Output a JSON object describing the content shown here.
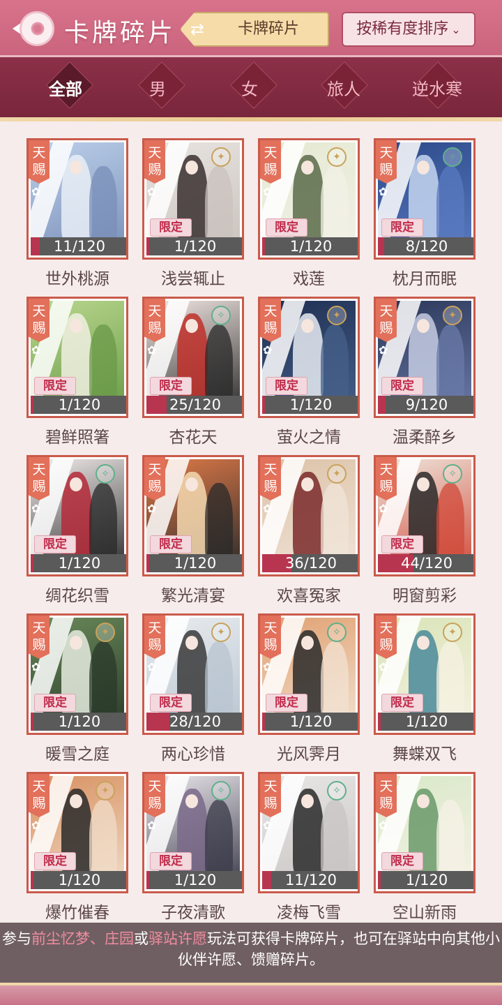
{
  "header": {
    "title": "卡牌碎片",
    "switch_label": "卡牌碎片",
    "sort_label": "按稀有度排序"
  },
  "filters": [
    "全部",
    "男",
    "女",
    "旅人",
    "逆水寒"
  ],
  "active_filter": "全部",
  "colors": {
    "header": "#d9738c",
    "filter_bar": "#8b3048",
    "card_border": "#c95a4a",
    "tianci_tag": "#e2705a",
    "progress_fill": "#b8354f",
    "limited_text": "#c02a4a",
    "highlight": "#f08ca0"
  },
  "cards": [
    {
      "name": "世外桃源",
      "count": "11/120",
      "fraction": 0.092,
      "tag": "天赐",
      "limited": false,
      "badge": "none",
      "palette": [
        "#bcd0ea",
        "#e9eef7",
        "#7a8fb8"
      ]
    },
    {
      "name": "浅尝辄止",
      "count": "1/120",
      "fraction": 0.008,
      "tag": "天赐",
      "limited": true,
      "badge": "gold",
      "palette": [
        "#e8e4e0",
        "#3a3030",
        "#c9c2bd"
      ]
    },
    {
      "name": "戏莲",
      "count": "1/120",
      "fraction": 0.008,
      "tag": "天赐",
      "limited": true,
      "badge": "gold",
      "palette": [
        "#e5ead3",
        "#5b6b4a",
        "#f2f0e6"
      ]
    },
    {
      "name": "枕月而眠",
      "count": "8/120",
      "fraction": 0.067,
      "tag": "天赐",
      "limited": true,
      "badge": "green",
      "palette": [
        "#2c4a8a",
        "#c6d6f0",
        "#5a7ac0"
      ]
    },
    {
      "name": "碧鲜照箸",
      "count": "1/120",
      "fraction": 0.008,
      "tag": "天赐",
      "limited": true,
      "badge": "none",
      "palette": [
        "#b9d78e",
        "#f0f0e0",
        "#6a9a48"
      ]
    },
    {
      "name": "杏花天",
      "count": "25/120",
      "fraction": 0.208,
      "tag": "天赐",
      "limited": true,
      "badge": "green",
      "palette": [
        "#f3e7e3",
        "#c0302a",
        "#2a2a2a"
      ]
    },
    {
      "name": "萤火之情",
      "count": "1/120",
      "fraction": 0.008,
      "tag": "天赐",
      "limited": true,
      "badge": "gold",
      "palette": [
        "#1f2f52",
        "#e8ecf2",
        "#46608a"
      ]
    },
    {
      "name": "温柔醉乡",
      "count": "9/120",
      "fraction": 0.075,
      "tag": "天赐",
      "limited": true,
      "badge": "gold",
      "palette": [
        "#2a3658",
        "#c4cce2",
        "#6a7aa8"
      ]
    },
    {
      "name": "绸花织雪",
      "count": "1/120",
      "fraction": 0.008,
      "tag": "天赐",
      "limited": true,
      "badge": "green",
      "palette": [
        "#f3ecec",
        "#b52a3a",
        "#2a2a2a"
      ]
    },
    {
      "name": "繁光清宴",
      "count": "1/120",
      "fraction": 0.008,
      "tag": "天赐",
      "limited": true,
      "badge": "none",
      "palette": [
        "#e07a48",
        "#f5d9b0",
        "#2a2a2a"
      ]
    },
    {
      "name": "欢喜冤家",
      "count": "36/120",
      "fraction": 0.3,
      "tag": "天赐",
      "limited": false,
      "badge": "gold",
      "palette": [
        "#dcc2a8",
        "#7a2a2a",
        "#f0e4d8"
      ]
    },
    {
      "name": "明窗剪彩",
      "count": "44/120",
      "fraction": 0.367,
      "tag": "天赐",
      "limited": true,
      "badge": "green",
      "palette": [
        "#efe6dc",
        "#2a2a2a",
        "#d04a3a"
      ]
    },
    {
      "name": "暖雪之庭",
      "count": "1/120",
      "fraction": 0.008,
      "tag": "天赐",
      "limited": true,
      "badge": "gold",
      "palette": [
        "#6a8a5a",
        "#e6ece0",
        "#2a3a2a"
      ]
    },
    {
      "name": "两心珍惜",
      "count": "28/120",
      "fraction": 0.233,
      "tag": "天赐",
      "limited": true,
      "badge": "gold",
      "palette": [
        "#e9ecef",
        "#3a3a3a",
        "#b8c4d0"
      ]
    },
    {
      "name": "光风霁月",
      "count": "1/120",
      "fraction": 0.008,
      "tag": "天赐",
      "limited": true,
      "badge": "green",
      "palette": [
        "#e0a070",
        "#2a2a2a",
        "#f2e2d2"
      ]
    },
    {
      "name": "舞蝶双飞",
      "count": "1/120",
      "fraction": 0.008,
      "tag": "天赐",
      "limited": true,
      "badge": "gold",
      "palette": [
        "#d9e4b8",
        "#4a8a9a",
        "#f6f2e2"
      ]
    },
    {
      "name": "爆竹催春",
      "count": "1/120",
      "fraction": 0.008,
      "tag": "天赐",
      "limited": true,
      "badge": "gold",
      "palette": [
        "#d89060",
        "#2a2a2a",
        "#f0dcc8"
      ]
    },
    {
      "name": "子夜清歌",
      "count": "1/120",
      "fraction": 0.008,
      "tag": "天赐",
      "limited": true,
      "badge": "green",
      "palette": [
        "#ece8ee",
        "#7a6a8a",
        "#3a3a48"
      ]
    },
    {
      "name": "凌梅飞雪",
      "count": "11/120",
      "fraction": 0.092,
      "tag": "天赐",
      "limited": false,
      "badge": "green",
      "palette": [
        "#e8e6e6",
        "#2a2a2a",
        "#c9c4c4"
      ]
    },
    {
      "name": "空山新雨",
      "count": "1/120",
      "fraction": 0.008,
      "tag": "天赐",
      "limited": true,
      "badge": "none",
      "palette": [
        "#d8e8c8",
        "#6a9a6a",
        "#f6f2e6"
      ]
    }
  ],
  "limited_label": "限定",
  "tip": {
    "prefix": "参与",
    "source1": "前尘忆梦",
    "sep1": "、",
    "source2": "庄园",
    "sep2": "或",
    "source3": "驿站许愿",
    "suffix": "玩法可获得卡牌碎片，也可在驿站中向其他小伙伴许愿、馈赠碎片。"
  }
}
